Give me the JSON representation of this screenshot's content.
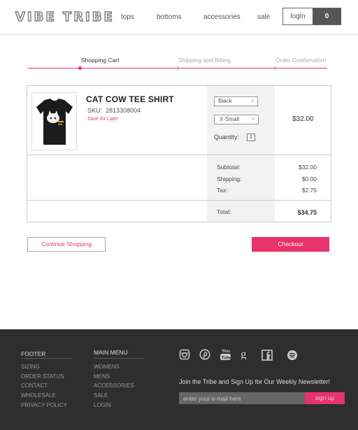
{
  "header": {
    "logo": "VIBE TRIBE",
    "nav": [
      "tops",
      "bottoms",
      "accessories",
      "sale"
    ],
    "login": "login",
    "cart_count": "0"
  },
  "steps": [
    {
      "label": "Shopping Cart",
      "active": true
    },
    {
      "label": "Shipping and Billing",
      "active": false
    },
    {
      "label": "Order Confirmation",
      "active": false
    }
  ],
  "cart": {
    "item": {
      "title": "CAT COW TEE SHIRT",
      "sku_label": "SKU:",
      "sku": "2813308004",
      "save_for_later": "Save for Later",
      "color": "Black",
      "size": "X-Small",
      "quantity_label": "Quantity:",
      "quantity": "1",
      "price": "$32.00"
    },
    "summary": {
      "subtotal_label": "Subtotal:",
      "subtotal": "$32.00",
      "shipping_label": "Shipping:",
      "shipping": "$0.00",
      "tax_label": "Tax:",
      "tax": "$2.75",
      "total_label": "Total:",
      "total": "$34.75"
    }
  },
  "buttons": {
    "continue": "Continue Shopping",
    "checkout": "Checkout"
  },
  "footer": {
    "col1_title": "FOOTER",
    "col1_links": [
      "SIZING",
      "ORDER STATUS",
      "CONTACT",
      "WHOLESALE",
      "PRIVACY POLICY"
    ],
    "col2_title": "MAIN MENU",
    "col2_links": [
      "WOMENS",
      "MENS",
      "ACCESSORIES",
      "SALE",
      "LOGIN"
    ],
    "social_icons": [
      "instagram-icon",
      "pinterest-icon",
      "youtube-icon",
      "google-plus-icon",
      "facebook-icon",
      "spotify-icon"
    ],
    "newsletter_text": "Join the Tribe and Sign Up for Our Weekly Newsletter!",
    "email_placeholder": "enter your e-mail here",
    "signup": "sign up"
  },
  "colors": {
    "accent": "#e8336d",
    "footer_bg": "#2e2e2e"
  }
}
